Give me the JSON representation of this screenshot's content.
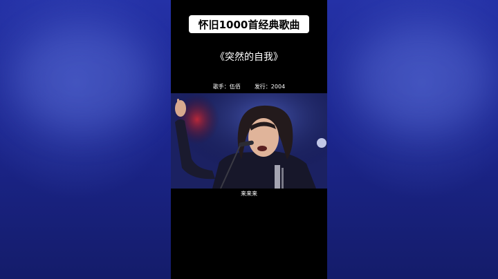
{
  "header": {
    "badge_text": "怀旧1000首经典歌曲"
  },
  "song": {
    "title": "《突然的自我》",
    "singer_label": "歌手：伍佰",
    "release_label": "发行：2004"
  },
  "video": {
    "subtitle": "来来来"
  },
  "colors": {
    "side_background": "#1f2a9a",
    "phone_background": "#000000",
    "badge_background": "#ffffff"
  }
}
